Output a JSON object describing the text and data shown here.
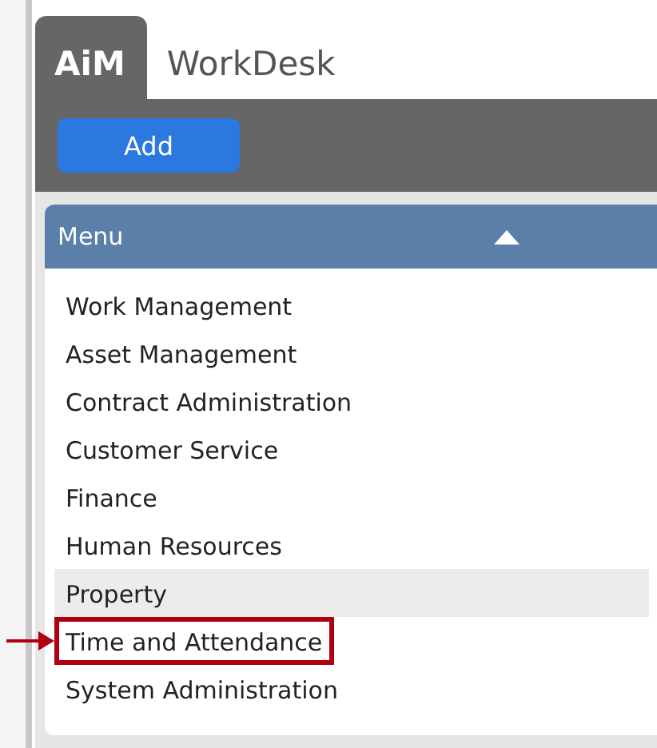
{
  "tabs": [
    {
      "label": "AiM",
      "selected": true
    },
    {
      "label": "WorkDesk",
      "selected": false
    }
  ],
  "toolbar": {
    "add_button": "Add"
  },
  "menu": {
    "title": "Menu",
    "expanded": true,
    "items": [
      {
        "label": "Work Management",
        "highlighted": false,
        "annotated": false
      },
      {
        "label": "Asset Management",
        "highlighted": false,
        "annotated": false
      },
      {
        "label": "Contract Administration",
        "highlighted": false,
        "annotated": false
      },
      {
        "label": "Customer Service",
        "highlighted": false,
        "annotated": false
      },
      {
        "label": "Finance",
        "highlighted": false,
        "annotated": false
      },
      {
        "label": "Human Resources",
        "highlighted": false,
        "annotated": false
      },
      {
        "label": "Property",
        "highlighted": true,
        "annotated": false
      },
      {
        "label": "Time and Attendance",
        "highlighted": false,
        "annotated": true
      },
      {
        "label": "System Administration",
        "highlighted": false,
        "annotated": false
      }
    ]
  }
}
